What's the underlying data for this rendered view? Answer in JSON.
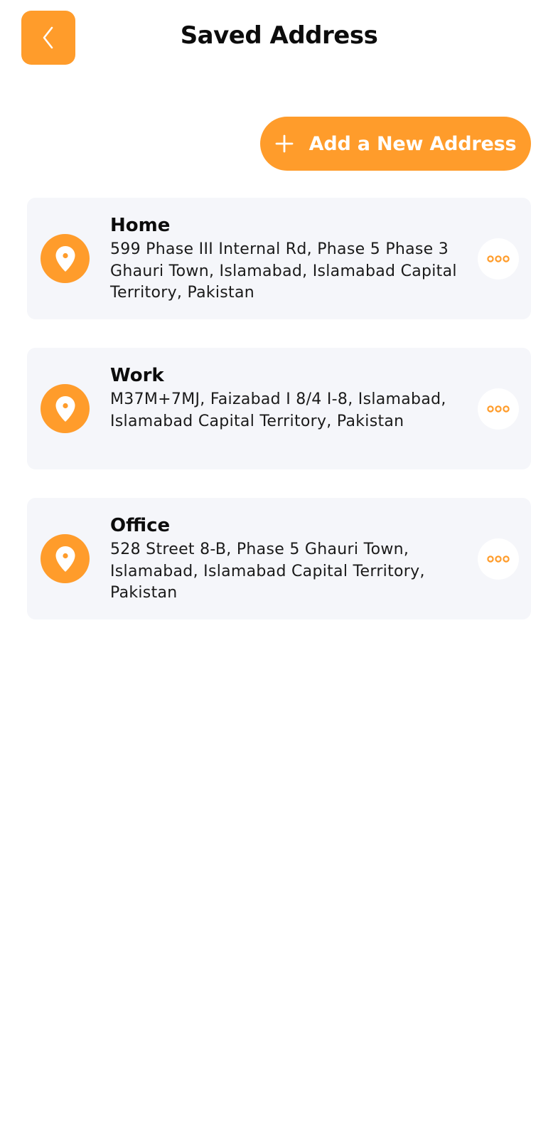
{
  "header": {
    "title": "Saved Address",
    "back_icon": "chevron-left-icon"
  },
  "actions": {
    "add_label": "Add a New Address",
    "add_icon": "plus-icon"
  },
  "colors": {
    "accent": "#FF9C2B",
    "card_bg": "#F5F6FA",
    "text": "#111111"
  },
  "addresses": [
    {
      "title": "Home",
      "address": "599 Phase III Internal Rd, Phase 5 Phase 3 Ghauri Town, Islamabad, Islamabad Capital Territory, Pakistan",
      "icon": "location-pin-icon",
      "menu_icon": "more-options-icon"
    },
    {
      "title": "Work",
      "address": "M37M+7MJ, Faizabad I 8/4 I-8, Islamabad, Islamabad Capital Territory, Pakistan",
      "icon": "location-pin-icon",
      "menu_icon": "more-options-icon"
    },
    {
      "title": "Office",
      "address": "528 Street 8-B, Phase 5 Ghauri Town, Islamabad, Islamabad Capital Territory, Pakistan",
      "icon": "location-pin-icon",
      "menu_icon": "more-options-icon"
    }
  ]
}
